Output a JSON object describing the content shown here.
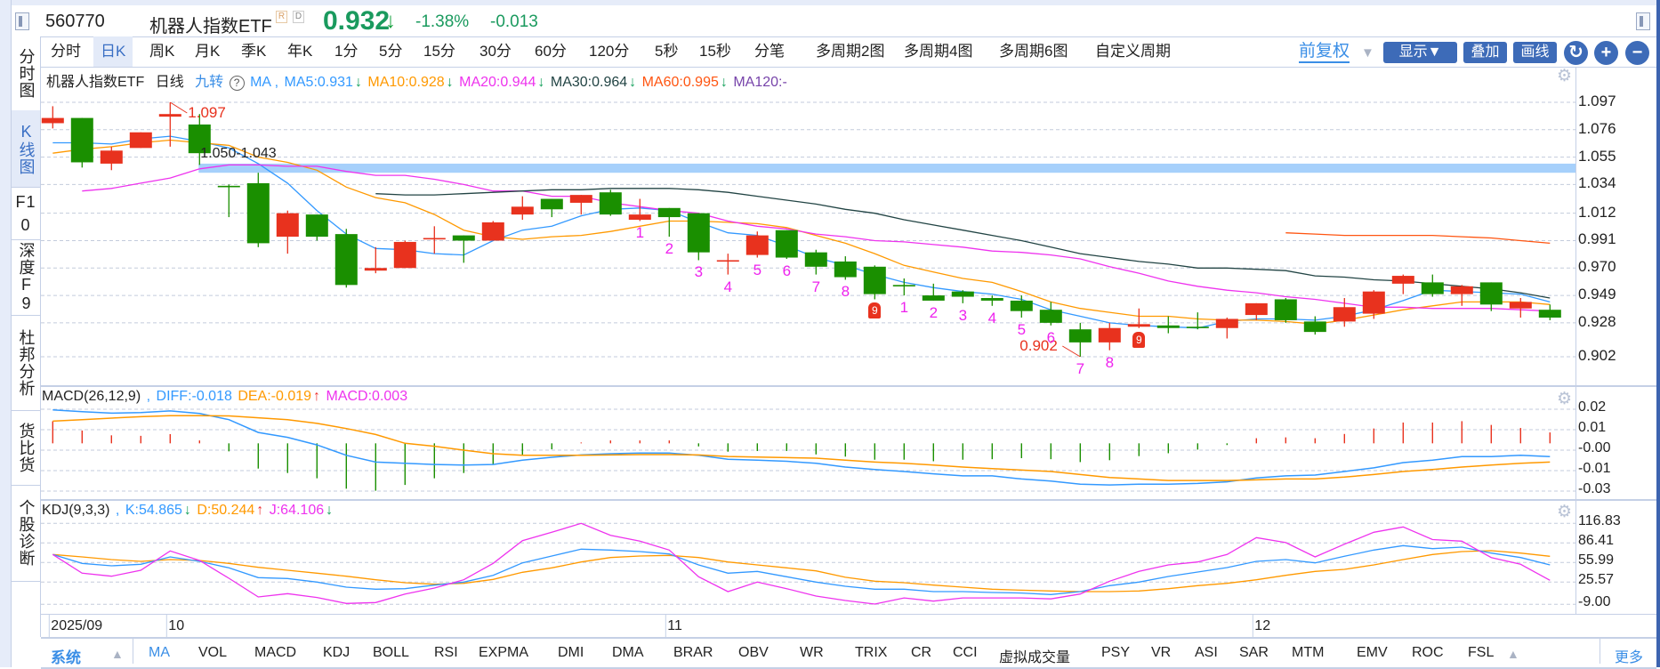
{
  "header": {
    "code": "560770",
    "name": "机器人指数ETF",
    "badges": [
      "R",
      "D"
    ],
    "price": "0.932",
    "price_arrow": "↓",
    "change_pct": "-1.38%",
    "change": "-0.013",
    "colors": {
      "down": "#1a9a5e",
      "up": "#e8321e"
    }
  },
  "nav": [
    {
      "label": "分时图"
    },
    {
      "label": "K线图",
      "active": true
    },
    {
      "label": "F10"
    },
    {
      "label": "深度F9"
    },
    {
      "label": "杜邦分析"
    },
    {
      "label": "货比货"
    },
    {
      "label": "个股诊断"
    }
  ],
  "tabs": [
    "分时",
    "日K",
    "周K",
    "月K",
    "季K",
    "年K",
    "1分",
    "5分",
    "15分",
    "30分",
    "60分",
    "120分",
    "5秒",
    "15秒",
    "分笔",
    "多周期2图",
    "多周期4图",
    "多周期6图",
    "自定义周期"
  ],
  "active_tab": "日K",
  "toolbar": {
    "adjust": "前复权",
    "adjust_arrow": "▼",
    "display": "显示▼",
    "overlay": "叠加",
    "draw": "画线",
    "refresh_icon": "refresh-icon",
    "zoom_in": "+",
    "zoom_out": "−"
  },
  "main_legend": {
    "title": "机器人指数ETF",
    "period": "日线",
    "nine_turn": "九转",
    "help": "?",
    "ma_prefix": "MA ,",
    "ma5": "MA5:0.931",
    "ma5_arrow": "↓",
    "ma10": "MA10:0.928",
    "ma10_arrow": "↓",
    "ma20": "MA20:0.944",
    "ma20_arrow": "↓",
    "ma30": "MA30:0.964",
    "ma30_arrow": "↓",
    "ma60": "MA60:0.995",
    "ma60_arrow": "↓",
    "ma120": "MA120:-"
  },
  "macd_legend": {
    "name": "MACD(26,12,9)",
    "sep": ",",
    "diff": "DIFF:-0.018",
    "dea": "DEA:-0.019",
    "dea_arrow": "↑",
    "macd": "MACD:0.003"
  },
  "kdj_legend": {
    "name": "KDJ(9,3,3)",
    "sep": ",",
    "k": "K:54.865",
    "k_arrow": "↓",
    "d": "D:50.244",
    "d_arrow": "↑",
    "j": "J:64.106",
    "j_arrow": "↓"
  },
  "annotations": {
    "high": "1.097",
    "low": "0.902",
    "band": "1.050-1.043"
  },
  "bottom_bar": {
    "system": "系统",
    "system_arrow": "▲",
    "items": [
      "MA",
      "VOL",
      "MACD",
      "KDJ",
      "BOLL",
      "RSI",
      "EXPMA",
      "DMI",
      "DMA",
      "BRAR",
      "OBV",
      "WR",
      "TRIX",
      "CR",
      "CCI",
      "虚拟成交量",
      "PSY",
      "VR",
      "ASI",
      "SAR",
      "MTM",
      "EMV",
      "ROC",
      "FSL"
    ],
    "active": "MA",
    "more_arrow": "▲",
    "more": "更多"
  },
  "chart_data": [
    {
      "type": "candlestick",
      "panel": "main",
      "ylim": [
        0.902,
        1.097
      ],
      "y_ticks": [
        "1.097",
        "1.076",
        "1.055",
        "1.034",
        "1.012",
        "0.991",
        "0.970",
        "0.949",
        "0.928",
        "0.902"
      ],
      "grid": true,
      "date_axis": [
        {
          "label": "2025/09",
          "candle_index": 0
        },
        {
          "label": "10",
          "candle_index": 4
        },
        {
          "label": "11",
          "candle_index": 21
        },
        {
          "label": "12",
          "candle_index": 41
        }
      ],
      "candle_fields": [
        "open",
        "high",
        "low",
        "close"
      ],
      "candles": [
        [
          1.081,
          1.094,
          1.077,
          1.085
        ],
        [
          1.085,
          1.085,
          1.047,
          1.051
        ],
        [
          1.05,
          1.063,
          1.045,
          1.06
        ],
        [
          1.062,
          1.074,
          1.062,
          1.074
        ],
        [
          1.086,
          1.097,
          1.063,
          1.088
        ],
        [
          1.08,
          1.088,
          1.049,
          1.058
        ],
        [
          1.033,
          1.034,
          1.009,
          1.032
        ],
        [
          1.035,
          1.043,
          0.986,
          0.989
        ],
        [
          0.994,
          1.014,
          0.981,
          1.012
        ],
        [
          1.011,
          1.011,
          0.991,
          0.994
        ],
        [
          0.996,
          1.0,
          0.955,
          0.957
        ],
        [
          0.968,
          0.986,
          0.966,
          0.97
        ],
        [
          0.97,
          0.991,
          0.97,
          0.99
        ],
        [
          0.992,
          1.002,
          0.981,
          0.993
        ],
        [
          0.995,
          0.995,
          0.974,
          0.991
        ],
        [
          0.991,
          1.006,
          0.991,
          1.005
        ],
        [
          1.011,
          1.025,
          1.007,
          1.017
        ],
        [
          1.023,
          1.023,
          1.009,
          1.015
        ],
        [
          1.02,
          1.026,
          1.011,
          1.026
        ],
        [
          1.028,
          1.03,
          1.01,
          1.011
        ],
        [
          1.007,
          1.023,
          1.006,
          1.011
        ],
        [
          1.016,
          1.016,
          0.994,
          1.009
        ],
        [
          1.012,
          1.012,
          0.976,
          0.982
        ],
        [
          0.975,
          0.981,
          0.965,
          0.976
        ],
        [
          0.98,
          0.998,
          0.978,
          0.995
        ],
        [
          0.999,
          0.999,
          0.977,
          0.978
        ],
        [
          0.982,
          0.984,
          0.965,
          0.971
        ],
        [
          0.975,
          0.979,
          0.961,
          0.963
        ],
        [
          0.971,
          0.972,
          0.946,
          0.95
        ],
        [
          0.957,
          0.962,
          0.949,
          0.957
        ],
        [
          0.949,
          0.958,
          0.945,
          0.945
        ],
        [
          0.952,
          0.953,
          0.943,
          0.948
        ],
        [
          0.947,
          0.949,
          0.941,
          0.945
        ],
        [
          0.945,
          0.949,
          0.932,
          0.937
        ],
        [
          0.938,
          0.944,
          0.926,
          0.928
        ],
        [
          0.923,
          0.928,
          0.902,
          0.913
        ],
        [
          0.913,
          0.928,
          0.907,
          0.924
        ],
        [
          0.925,
          0.939,
          0.924,
          0.927
        ],
        [
          0.926,
          0.933,
          0.92,
          0.924
        ],
        [
          0.925,
          0.936,
          0.923,
          0.925
        ],
        [
          0.924,
          0.932,
          0.916,
          0.931
        ],
        [
          0.934,
          0.943,
          0.93,
          0.943
        ],
        [
          0.946,
          0.947,
          0.928,
          0.93
        ],
        [
          0.929,
          0.933,
          0.919,
          0.921
        ],
        [
          0.929,
          0.947,
          0.925,
          0.94
        ],
        [
          0.935,
          0.953,
          0.931,
          0.952
        ],
        [
          0.958,
          0.965,
          0.95,
          0.964
        ],
        [
          0.959,
          0.965,
          0.948,
          0.95
        ],
        [
          0.95,
          0.957,
          0.941,
          0.956
        ],
        [
          0.959,
          0.959,
          0.937,
          0.942
        ],
        [
          0.939,
          0.947,
          0.932,
          0.944
        ],
        [
          0.938,
          0.942,
          0.93,
          0.932
        ]
      ],
      "colors": {
        "up": "#e8321e",
        "down": "#1a8f00",
        "band": "#a6d0fb"
      },
      "band": {
        "from": 1.05,
        "to": 1.043,
        "start_index": 6
      },
      "high_mark": {
        "index": 4,
        "value": 1.097
      },
      "low_mark": {
        "index": 35,
        "value": 0.902
      },
      "td_sequences": [
        {
          "start_index": 20,
          "labels": [
            "1",
            "2",
            "3",
            "4",
            "5",
            "6",
            "7",
            "8",
            "9"
          ]
        },
        {
          "start_index": 29,
          "labels": [
            "1",
            "2",
            "3",
            "4",
            "5",
            "6",
            "7",
            "8",
            "9"
          ]
        }
      ],
      "series": [
        {
          "name": "MA5",
          "color": "#3399ff",
          "values": [
            1.066,
            1.066,
            1.065,
            1.069,
            1.071,
            1.067,
            1.062,
            1.05,
            1.035,
            1.014,
            0.996,
            0.985,
            0.984,
            0.981,
            0.98,
            0.991,
            0.999,
            1.002,
            1.01,
            1.015,
            1.016,
            1.014,
            1.005,
            0.997,
            0.995,
            0.987,
            0.978,
            0.972,
            0.965,
            0.959,
            0.955,
            0.952,
            0.95,
            0.946,
            0.938,
            0.933,
            0.928,
            0.926,
            0.925,
            0.924,
            0.929,
            0.931,
            0.931,
            0.93,
            0.933,
            0.938,
            0.945,
            0.953,
            0.952,
            0.951,
            0.95,
            0.944
          ]
        },
        {
          "name": "MA10",
          "color": "#ff9900",
          "values": [
            1.058,
            1.061,
            1.063,
            1.066,
            1.068,
            1.066,
            1.064,
            1.055,
            1.051,
            1.045,
            1.032,
            1.024,
            1.02,
            1.011,
            0.999,
            0.994,
            0.992,
            0.994,
            0.995,
            0.998,
            1.002,
            1.006,
            1.006,
            1.005,
            1.004,
            1.001,
            0.995,
            0.989,
            0.981,
            0.972,
            0.967,
            0.962,
            0.959,
            0.952,
            0.944,
            0.939,
            0.936,
            0.933,
            0.933,
            0.931,
            0.93,
            0.93,
            0.929,
            0.927,
            0.93,
            0.934,
            0.938,
            0.941,
            0.944,
            0.944,
            0.944,
            0.942
          ]
        },
        {
          "name": "MA20",
          "color": "#ee33ee",
          "values": [
            null,
            1.029,
            1.031,
            1.035,
            1.039,
            1.046,
            1.049,
            1.049,
            1.048,
            1.048,
            1.044,
            1.041,
            1.041,
            1.038,
            1.034,
            1.029,
            1.029,
            1.025,
            1.025,
            1.02,
            1.017,
            1.014,
            1.012,
            1.006,
            1.002,
            1.0,
            0.996,
            0.994,
            0.991,
            0.99,
            0.988,
            0.986,
            0.983,
            0.982,
            0.98,
            0.977,
            0.971,
            0.966,
            0.96,
            0.956,
            0.953,
            0.951,
            0.948,
            0.946,
            0.943,
            0.94,
            0.94,
            0.939,
            0.939,
            0.939,
            0.938,
            0.937
          ]
        },
        {
          "name": "MA30",
          "color": "#224444",
          "values": [
            null,
            null,
            null,
            null,
            null,
            null,
            null,
            null,
            null,
            null,
            null,
            1.027,
            1.026,
            1.026,
            1.027,
            1.028,
            1.029,
            1.03,
            1.03,
            1.031,
            1.031,
            1.031,
            1.03,
            1.028,
            1.025,
            1.022,
            1.019,
            1.015,
            1.012,
            1.007,
            1.003,
            0.999,
            0.995,
            0.991,
            0.986,
            0.981,
            0.978,
            0.975,
            0.973,
            0.97,
            0.97,
            0.969,
            0.968,
            0.964,
            0.963,
            0.961,
            0.96,
            0.958,
            0.956,
            0.954,
            0.951,
            0.947
          ]
        },
        {
          "name": "MA60",
          "color": "#ff5511",
          "values": [
            null,
            null,
            null,
            null,
            null,
            null,
            null,
            null,
            null,
            null,
            null,
            null,
            null,
            null,
            null,
            null,
            null,
            null,
            null,
            null,
            null,
            null,
            null,
            null,
            null,
            null,
            null,
            null,
            null,
            null,
            null,
            null,
            null,
            null,
            null,
            null,
            null,
            null,
            null,
            null,
            null,
            null,
            0.997,
            0.996,
            0.995,
            0.995,
            0.995,
            0.995,
            0.994,
            0.993,
            0.991,
            0.989
          ]
        }
      ]
    },
    {
      "type": "bar+line",
      "panel": "MACD",
      "ylim": [
        -0.028,
        0.02
      ],
      "y_ticks": [
        "0.02",
        "0.01",
        "-0.00",
        "-0.01",
        "-0.03"
      ],
      "grid": true,
      "colors": {
        "diff": "#3399ff",
        "dea": "#ff9900",
        "up": "#e8321e",
        "down": "#1a8f00"
      },
      "macd": [
        0.013,
        0.0075,
        0.0047,
        0.0044,
        0.0054,
        0.0017,
        -0.0047,
        -0.0148,
        -0.0174,
        -0.0205,
        -0.0266,
        -0.0278,
        -0.0244,
        -0.0205,
        -0.0174,
        -0.0122,
        -0.007,
        -0.0035,
        0.0005,
        0.0017,
        0.0017,
        0.0017,
        -0.0018,
        -0.0049,
        -0.0045,
        -0.0045,
        -0.0065,
        -0.0078,
        -0.0096,
        -0.0096,
        -0.0105,
        -0.0096,
        -0.0093,
        -0.0087,
        -0.0093,
        -0.011,
        -0.0099,
        -0.0075,
        -0.0058,
        -0.0037,
        -0.001,
        0.003,
        0.0035,
        0.003,
        0.0055,
        0.0087,
        0.0122,
        0.0122,
        0.013,
        0.0108,
        0.009,
        0.0064
      ],
      "diff": [
        0.0196,
        0.0186,
        0.0177,
        0.018,
        0.019,
        0.0175,
        0.0139,
        0.0064,
        0.0035,
        -0.0009,
        -0.007,
        -0.011,
        -0.0117,
        -0.0124,
        -0.0127,
        -0.0124,
        -0.0099,
        -0.0082,
        -0.0068,
        -0.0061,
        -0.0057,
        -0.0057,
        -0.007,
        -0.0093,
        -0.0099,
        -0.0105,
        -0.0117,
        -0.0139,
        -0.0153,
        -0.0165,
        -0.0179,
        -0.0191,
        -0.0191,
        -0.0209,
        -0.0221,
        -0.024,
        -0.0244,
        -0.024,
        -0.024,
        -0.0235,
        -0.0226,
        -0.0203,
        -0.0191,
        -0.0186,
        -0.0165,
        -0.0144,
        -0.0113,
        -0.0099,
        -0.0078,
        -0.0078,
        -0.007,
        -0.0078
      ],
      "dea": [
        0.013,
        0.0139,
        0.0148,
        0.0156,
        0.0162,
        0.0162,
        0.0161,
        0.015,
        0.0139,
        0.0117,
        0.0087,
        0.0052,
        0.0,
        -0.0017,
        -0.004,
        -0.0061,
        -0.007,
        -0.007,
        -0.007,
        -0.0068,
        -0.0066,
        -0.0066,
        -0.0068,
        -0.0077,
        -0.008,
        -0.0084,
        -0.0087,
        -0.0099,
        -0.011,
        -0.0117,
        -0.0127,
        -0.0139,
        -0.0148,
        -0.0157,
        -0.0165,
        -0.0183,
        -0.02,
        -0.0209,
        -0.0218,
        -0.0218,
        -0.0218,
        -0.0214,
        -0.0209,
        -0.0209,
        -0.0198,
        -0.0183,
        -0.0165,
        -0.0153,
        -0.0139,
        -0.0127,
        -0.0117,
        -0.011
      ]
    },
    {
      "type": "line",
      "panel": "KDJ",
      "ylim": [
        -9.0,
        116.83
      ],
      "y_ticks": [
        "116.83",
        "86.41",
        "55.99",
        "25.57",
        "-9.00"
      ],
      "grid": true,
      "colors": {
        "k": "#3399ff",
        "d": "#ff9900",
        "j": "#ee33ee"
      },
      "k": [
        68.4,
        54.6,
        50.9,
        53.2,
        64.7,
        57.8,
        47.7,
        32.5,
        31.1,
        25.6,
        17.7,
        14.5,
        15.3,
        20.9,
        25.6,
        36.1,
        55.4,
        66.1,
        76.7,
        75.3,
        73,
        69.2,
        52.3,
        39.4,
        42.2,
        33.9,
        25.6,
        19.1,
        14.5,
        14.5,
        10.8,
        10.8,
        9.4,
        8.5,
        6.2,
        10.8,
        20,
        25.6,
        34.3,
        41.2,
        48.1,
        57.8,
        60.6,
        55.4,
        65.7,
        75.3,
        82.3,
        77.5,
        79.9,
        70.7,
        63.7,
        52.3
      ],
      "d": [
        68.4,
        64.7,
        60.5,
        57.8,
        60.5,
        59.2,
        54.6,
        48.5,
        44,
        39.4,
        34.7,
        29.2,
        24.6,
        22.3,
        23.7,
        29.7,
        40.8,
        47.7,
        56.8,
        63.7,
        66.1,
        67,
        63.7,
        56.8,
        52.3,
        47.7,
        43,
        33,
        27,
        24.6,
        20.9,
        17.7,
        14.5,
        13,
        11.7,
        10.8,
        10.8,
        11.7,
        15.3,
        20,
        23.7,
        29.2,
        36.1,
        42.1,
        45.3,
        52.3,
        60.5,
        68.4,
        73,
        74.4,
        70.7,
        65.7
      ],
      "j": [
        68.4,
        39.4,
        34.7,
        44,
        74,
        59.2,
        31.5,
        2.5,
        7.6,
        1.7,
        -7.6,
        -6.2,
        7.1,
        16.3,
        29.2,
        54.6,
        90,
        103,
        116.8,
        98.3,
        89.2,
        75.3,
        33.9,
        10.8,
        25.6,
        15.3,
        3.8,
        -3.1,
        -8.6,
        1,
        -4,
        1,
        1,
        1,
        -0.5,
        7.1,
        27,
        42.2,
        52.3,
        56.8,
        68.4,
        94.7,
        86.9,
        64.7,
        84.5,
        103,
        111.3,
        91.6,
        89.2,
        63.7,
        53.2,
        28.4
      ]
    }
  ]
}
